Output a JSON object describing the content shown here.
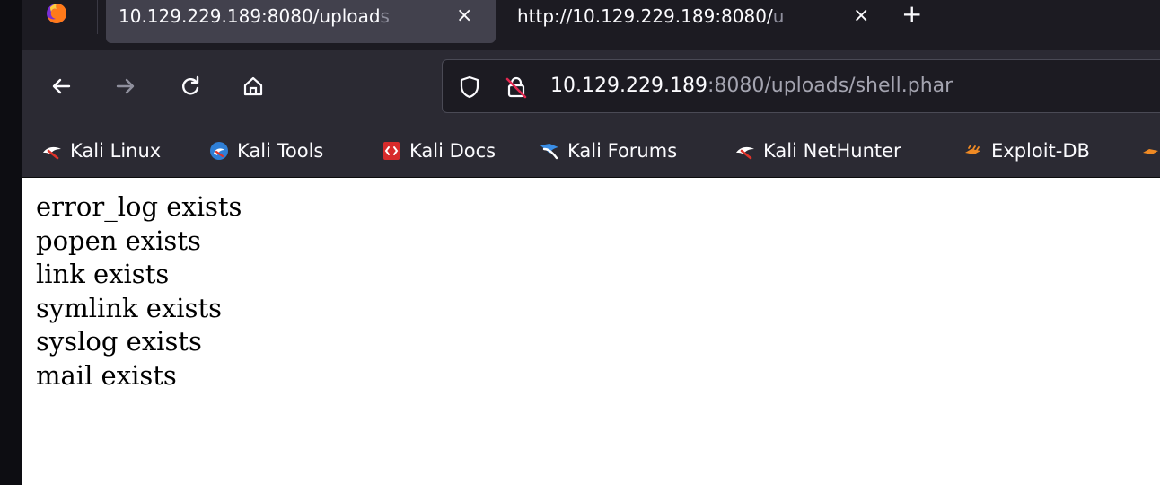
{
  "tabs": [
    {
      "title_main": "10.129.229.189:8080/upload",
      "title_fade": "s",
      "close_label": "×",
      "active": true
    },
    {
      "title_main": "http://10.129.229.189:8080/",
      "title_fade": "u",
      "close_label": "×",
      "active": false
    }
  ],
  "new_tab_label": "+",
  "urlbar": {
    "host": "10.129.229.189",
    "rest": ":8080/uploads/shell.phar"
  },
  "bookmarks": [
    {
      "label": "Kali Linux",
      "icon": "kali-dragon-icon"
    },
    {
      "label": "Kali Tools",
      "icon": "kali-tools-icon"
    },
    {
      "label": "Kali Docs",
      "icon": "kali-docs-icon"
    },
    {
      "label": "Kali Forums",
      "icon": "kali-forums-icon"
    },
    {
      "label": "Kali NetHunter",
      "icon": "kali-dragon-icon"
    },
    {
      "label": "Exploit-DB",
      "icon": "exploit-db-icon"
    }
  ],
  "output_lines": [
    "error_log exists",
    "popen exists",
    "link exists",
    "symlink exists",
    "syslog exists",
    "mail exists"
  ],
  "colors": {
    "tabstrip": "#1c1b22",
    "active_tab": "#42414d",
    "toolbar": "#2b2a33",
    "urlbar_bg": "#1c1b22",
    "text_light": "#fbfbfe",
    "content_bg": "#ffffff"
  }
}
